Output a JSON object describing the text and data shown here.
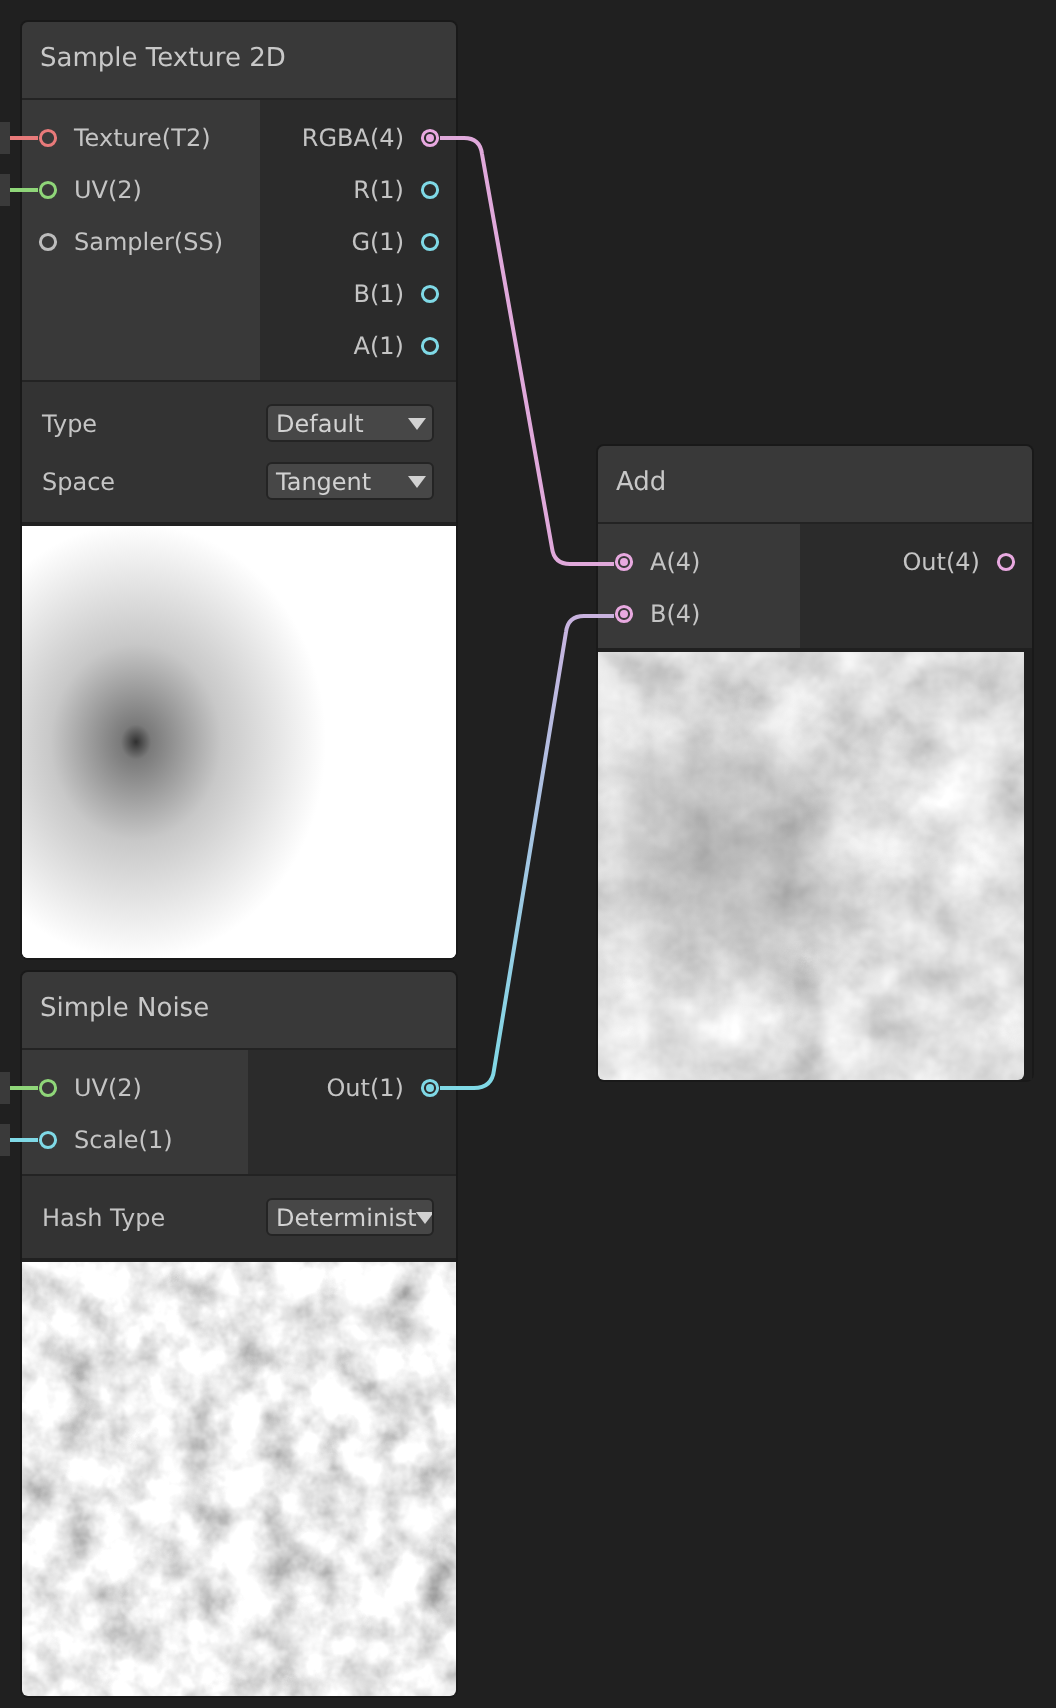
{
  "nodes": [
    {
      "title": "Sample Texture 2D",
      "preview": {
        "kind": "gradient"
      },
      "inputs": [
        {
          "label": "Texture(T2)",
          "color": "#e87a7a",
          "connected": false,
          "stub": true
        },
        {
          "label": "UV(2)",
          "color": "#8fd679",
          "connected": false,
          "stub": true
        },
        {
          "label": "Sampler(SS)",
          "color": "#bdbdbd",
          "connected": false,
          "stub": false
        }
      ],
      "outputs": [
        {
          "label": "RGBA(4)",
          "color": "#e8a9e0",
          "connected": true
        },
        {
          "label": "R(1)",
          "color": "#7fd9e6",
          "connected": false
        },
        {
          "label": "G(1)",
          "color": "#7fd9e6",
          "connected": false
        },
        {
          "label": "B(1)",
          "color": "#7fd9e6",
          "connected": false
        },
        {
          "label": "A(1)",
          "color": "#7fd9e6",
          "connected": false
        }
      ],
      "properties": [
        {
          "label": "Type",
          "value": "Default"
        },
        {
          "label": "Space",
          "value": "Tangent"
        }
      ]
    },
    {
      "title": "Add",
      "preview": {
        "kind": "noise-soft"
      },
      "inputs": [
        {
          "label": "A(4)",
          "color": "#e8a9e0",
          "connected": true,
          "stub": false
        },
        {
          "label": "B(4)",
          "color": "#e8a9e0",
          "connected": true,
          "stub": false
        }
      ],
      "outputs": [
        {
          "label": "Out(4)",
          "color": "#e8a9e0",
          "connected": false
        }
      ]
    },
    {
      "title": "Simple Noise",
      "preview": {
        "kind": "noise"
      },
      "inputs": [
        {
          "label": "UV(2)",
          "color": "#8fd679",
          "connected": false,
          "stub": true
        },
        {
          "label": "Scale(1)",
          "color": "#7fd9e6",
          "connected": false,
          "stub": true
        }
      ],
      "outputs": [
        {
          "label": "Out(1)",
          "color": "#7fd9e6",
          "connected": true
        }
      ],
      "properties": [
        {
          "label": "Hash Type",
          "value": "Determinist"
        }
      ]
    }
  ]
}
